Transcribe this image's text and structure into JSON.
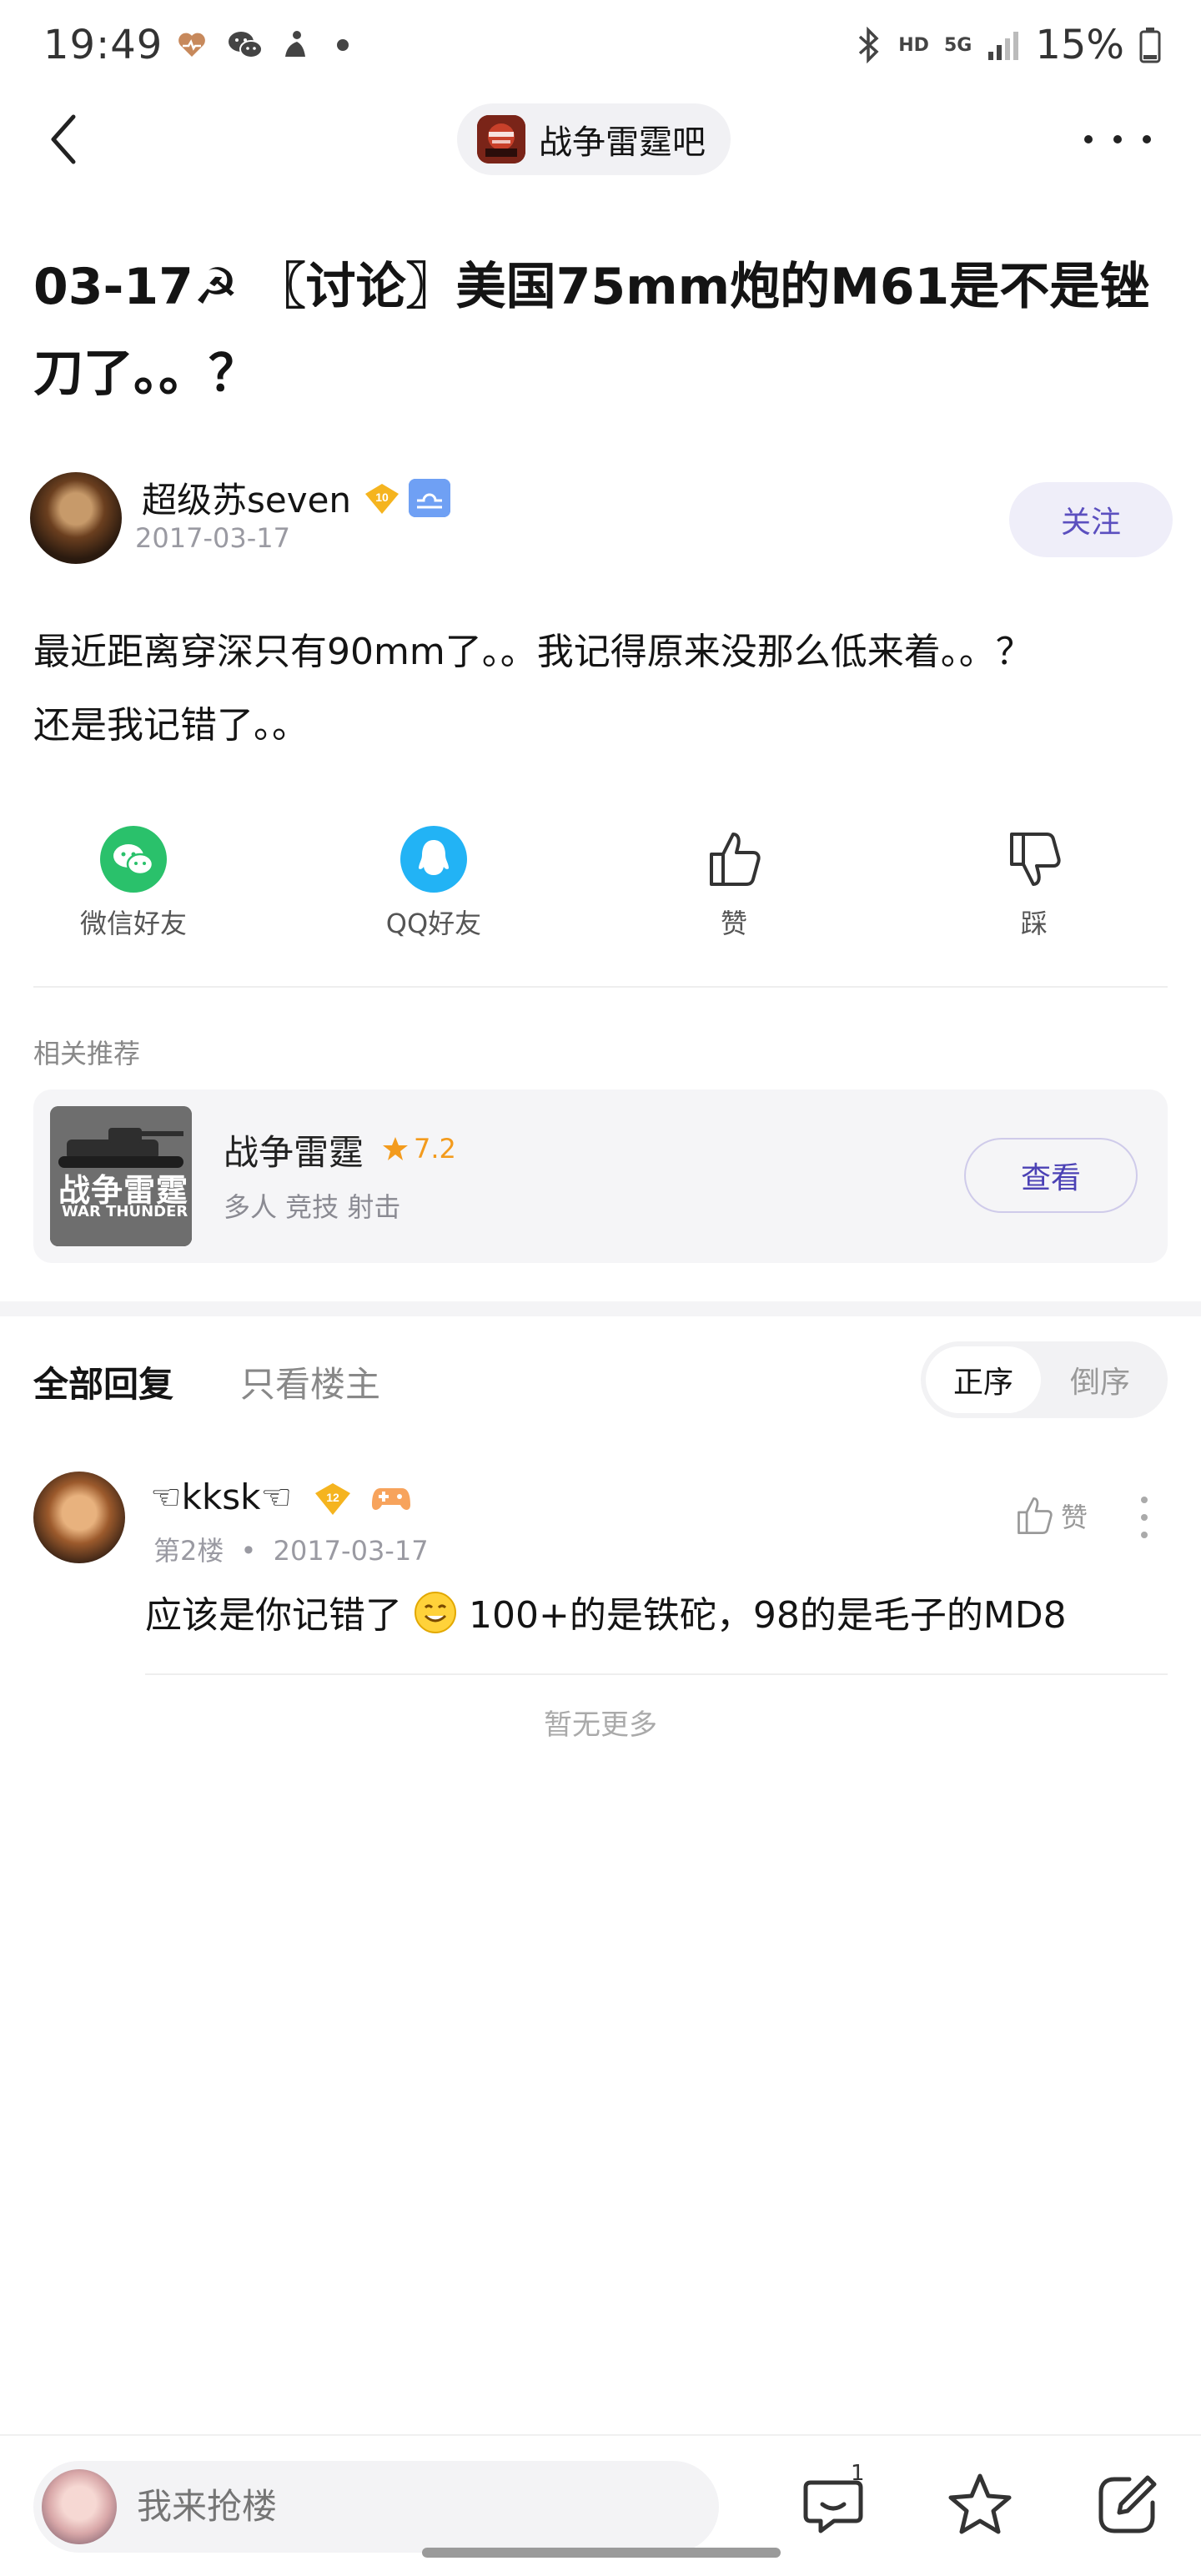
{
  "status_bar": {
    "time": "19:49",
    "network": "5G",
    "hd": "HD",
    "battery": "15%"
  },
  "nav": {
    "forum_name": "战争雷霆吧"
  },
  "post": {
    "title": "03-17☭ 〖讨论〗美国75mm炮的M61是不是锉刀了。。？",
    "author": {
      "name": "超级苏seven",
      "level": "10",
      "date": "2017-03-17"
    },
    "follow_label": "关注",
    "body_line1": "最近距离穿深只有90mm了。。我记得原来没那么低来着。。？",
    "body_line2": "还是我记错了。。"
  },
  "share": {
    "wechat_label": "微信好友",
    "qq_label": "QQ好友",
    "like_label": "赞",
    "dislike_label": "踩"
  },
  "related": {
    "section_title": "相关推荐",
    "game": {
      "thumb_text_cn": "战争雷霆",
      "thumb_text_en": "WAR THUNDER",
      "name": "战争雷霆",
      "rating": "7.2",
      "tags": "多人 竞技 射击",
      "view_label": "查看"
    }
  },
  "replies": {
    "tab_all": "全部回复",
    "tab_op_only": "只看楼主",
    "order_asc": "正序",
    "order_desc": "倒序",
    "items": [
      {
        "name": "☜kksk☜",
        "level": "12",
        "floor": "第2楼",
        "date": "2017-03-17",
        "like_label": "赞",
        "text_before_emoji": "应该是你记错了",
        "text_after_emoji": "100+的是铁砣，98的是毛子的MD8"
      }
    ],
    "no_more": "暂无更多"
  },
  "bottom_bar": {
    "input_placeholder": "我来抢楼",
    "comment_count": "1"
  },
  "colors": {
    "accent": "#5b4fbf",
    "wechat": "#2ac16b",
    "qq": "#22b3f5",
    "rating": "#f39b1d",
    "level_badge": "#f5b41f"
  }
}
